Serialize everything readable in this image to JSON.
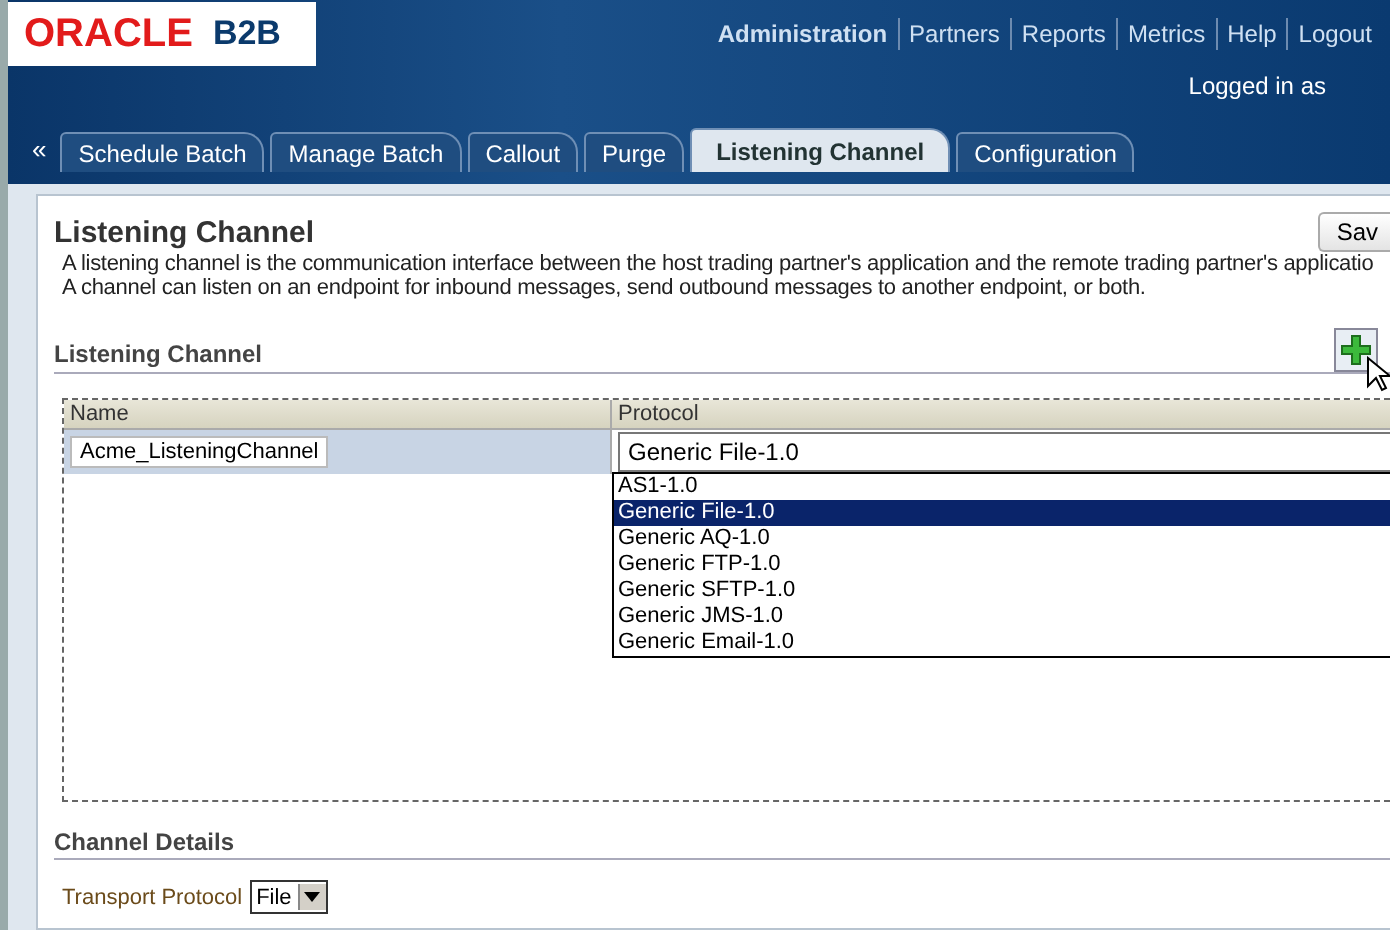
{
  "header": {
    "logo": {
      "brand": "ORACLE",
      "product": "B2B"
    },
    "nav": [
      {
        "label": "Administration",
        "selected": true
      },
      {
        "label": "Partners",
        "selected": false
      },
      {
        "label": "Reports",
        "selected": false
      },
      {
        "label": "Metrics",
        "selected": false
      },
      {
        "label": "Help",
        "selected": false
      },
      {
        "label": "Logout",
        "selected": false
      }
    ],
    "user_text": "Logged in as"
  },
  "tabs": {
    "scroll_left": "«",
    "items": [
      {
        "label": "Schedule Batch",
        "selected": false
      },
      {
        "label": "Manage Batch",
        "selected": false
      },
      {
        "label": "Callout",
        "selected": false
      },
      {
        "label": "Purge",
        "selected": false
      },
      {
        "label": "Listening Channel",
        "selected": true
      },
      {
        "label": "Configuration",
        "selected": false
      }
    ]
  },
  "panel": {
    "title": "Listening Channel",
    "save_button": "Sav",
    "description": [
      "A listening channel is the communication interface between the host trading partner's application and the remote trading partner's applicatio",
      "A channel can listen on an endpoint for inbound messages, send outbound messages to another endpoint, or both."
    ],
    "section_title": "Listening Channel",
    "table": {
      "columns": [
        "Name",
        "Protocol"
      ],
      "rows": [
        {
          "name": "Acme_ListeningChannel",
          "protocol": "Generic File-1.0",
          "selected": true
        }
      ],
      "dropdown_options": [
        {
          "label": "AS1-1.0",
          "selected": false
        },
        {
          "label": "Generic File-1.0",
          "selected": true
        },
        {
          "label": "Generic AQ-1.0",
          "selected": false
        },
        {
          "label": "Generic FTP-1.0",
          "selected": false
        },
        {
          "label": "Generic SFTP-1.0",
          "selected": false
        },
        {
          "label": "Generic JMS-1.0",
          "selected": false
        },
        {
          "label": "Generic Email-1.0",
          "selected": false
        }
      ]
    },
    "details": {
      "title": "Channel Details",
      "fields": [
        {
          "label": "Transport Protocol",
          "value": "File"
        }
      ]
    }
  }
}
